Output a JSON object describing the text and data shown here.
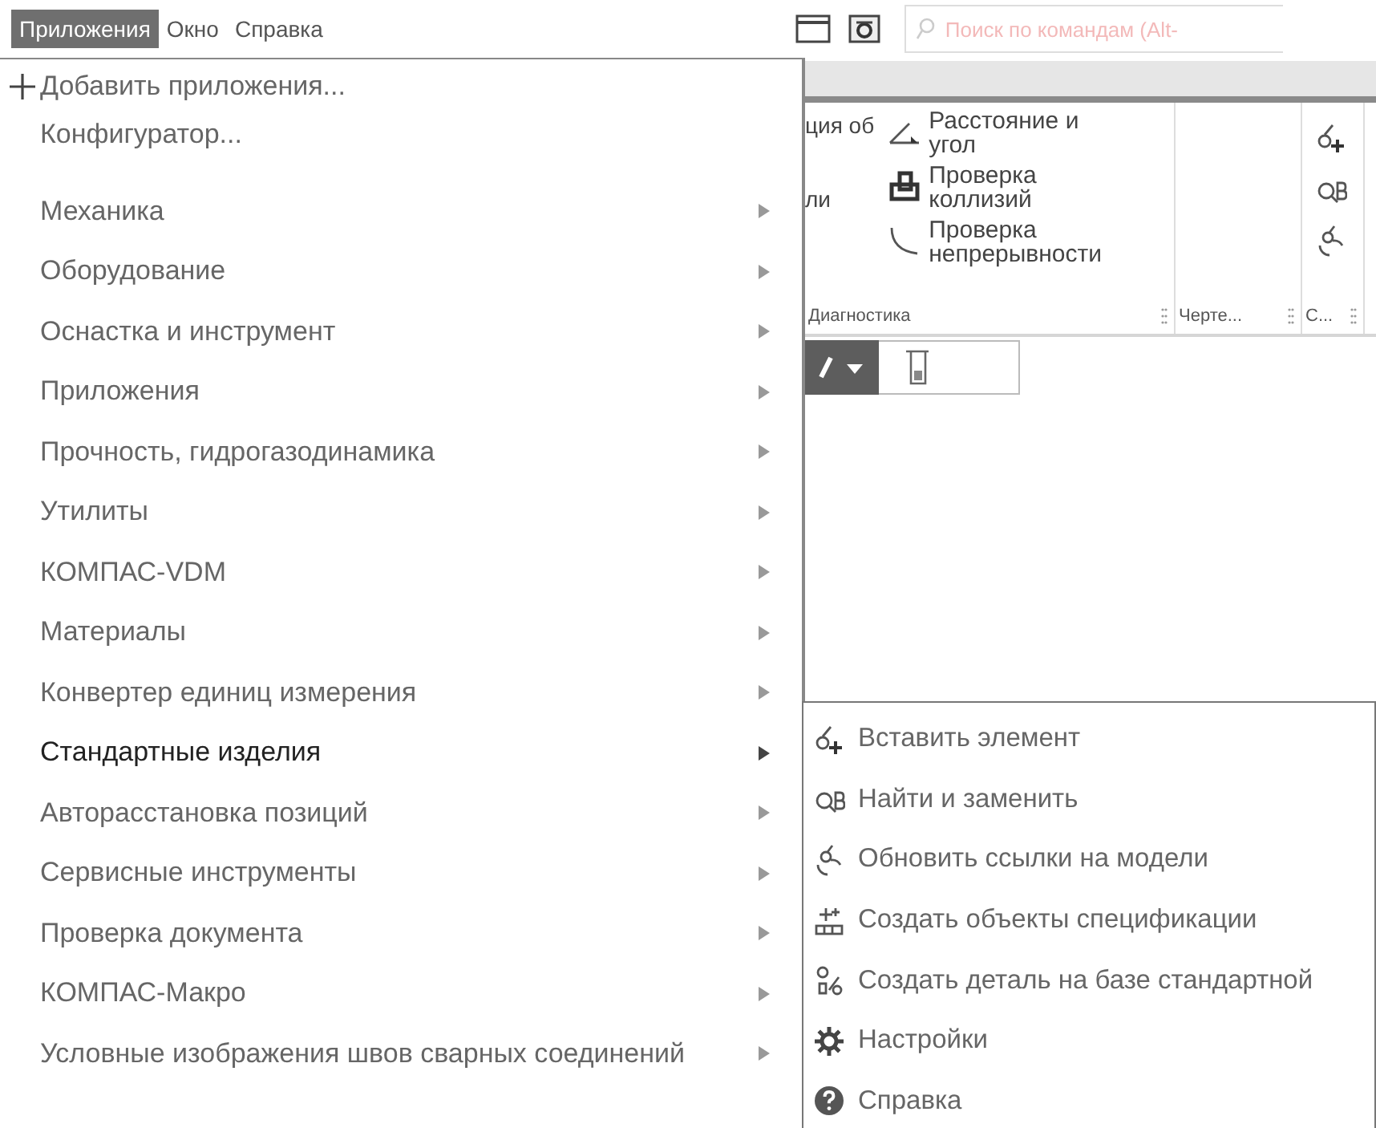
{
  "menubar": {
    "items": [
      {
        "label": "Приложения",
        "selected": true
      },
      {
        "label": "Окно",
        "selected": false
      },
      {
        "label": "Справка",
        "selected": false
      }
    ],
    "search": {
      "placeholder": "Поиск по командам (Alt-"
    }
  },
  "ribbon": {
    "cut_texts": [
      "ция об",
      "ли"
    ],
    "commands": [
      {
        "lines": [
          "Расстояние и",
          "угол"
        ]
      },
      {
        "lines": [
          "Проверка",
          "коллизий"
        ]
      },
      {
        "lines": [
          "Проверка",
          "непрерывности"
        ]
      }
    ],
    "groups": [
      "Диагностика",
      "Черте...",
      "С..."
    ]
  },
  "menu": {
    "groups": [
      [
        {
          "label": "Добавить приложения...",
          "kind": "add",
          "expanded": false
        },
        {
          "label": "Конфигуратор...",
          "kind": "command",
          "expanded": false
        }
      ],
      [
        {
          "label": "Механика",
          "kind": "submenu",
          "expanded": false
        },
        {
          "label": "Оборудование",
          "kind": "submenu",
          "expanded": false
        },
        {
          "label": "Оснастка и инструмент",
          "kind": "submenu",
          "expanded": false
        },
        {
          "label": "Приложения",
          "kind": "submenu",
          "expanded": false
        },
        {
          "label": "Прочность, гидрогазодинамика",
          "kind": "submenu",
          "expanded": false
        },
        {
          "label": "Утилиты",
          "kind": "submenu",
          "expanded": false
        },
        {
          "label": "КОМПАС-VDM",
          "kind": "submenu",
          "expanded": false
        },
        {
          "label": "Материалы",
          "kind": "submenu",
          "expanded": false
        },
        {
          "label": "Конвертер единиц измерения",
          "kind": "submenu",
          "expanded": false
        },
        {
          "label": "Стандартные изделия",
          "kind": "submenu",
          "expanded": true
        },
        {
          "label": "Авторасстановка позиций",
          "kind": "submenu",
          "expanded": false
        },
        {
          "label": "Сервисные инструменты",
          "kind": "submenu",
          "expanded": false
        },
        {
          "label": "Проверка документа",
          "kind": "submenu",
          "expanded": false
        },
        {
          "label": "КОМПАС-Макро",
          "kind": "submenu",
          "expanded": false
        },
        {
          "label": "Условные изображения швов сварных соединений",
          "kind": "submenu",
          "expanded": false
        }
      ]
    ]
  },
  "submenu": {
    "items": [
      "Вставить элемент",
      "Найти и заменить",
      "Обновить ссылки на модели",
      "Создать объекты спецификации",
      "Создать деталь на базе стандартной",
      "Настройки",
      "Справка"
    ]
  }
}
